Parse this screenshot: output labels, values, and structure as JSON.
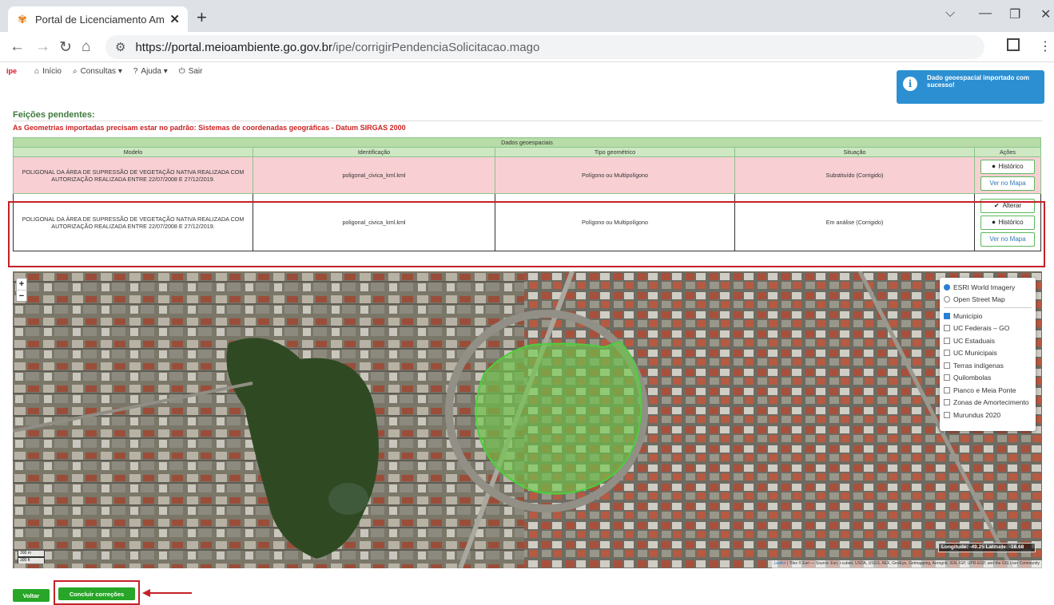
{
  "browser": {
    "tab_title": "Portal de Licenciamento Ambient",
    "tab_close": "✕",
    "new_tab": "+",
    "url_host": "https://portal.meioambiente.go.gov.br",
    "url_path": "/ipe/corrigirPendenciaSolicitacao.mago",
    "window_controls": [
      "⌵",
      "—",
      "❐",
      "✕"
    ]
  },
  "app_menu": {
    "logo": "ipe",
    "items": [
      {
        "icon": "home-icon",
        "glyph": "⌂",
        "label": "Início"
      },
      {
        "icon": "search-icon",
        "glyph": "⌕",
        "label": "Consultas ▾"
      },
      {
        "icon": "help-icon",
        "glyph": "?",
        "label": "Ajuda ▾"
      },
      {
        "icon": "power-icon",
        "glyph": "⏻",
        "label": "Sair"
      }
    ]
  },
  "toast": {
    "message": "Dado geoespacial importado com sucesso!",
    "color": "#2b8fd2"
  },
  "page": {
    "section_title": "Feições pendentes:",
    "warning": "As Geometrias importadas precisam estar no padrão: Sistemas de coordenadas geográficas - Datum SIRGAS 2000"
  },
  "table": {
    "group_header": "Dados geoespaciais",
    "columns": [
      "Modelo",
      "Identificação",
      "Tipo geométrico",
      "Situação",
      "Ações"
    ],
    "rows": [
      {
        "modelo": "POLIGONAL DA ÁREA DE SUPRESSÃO DE VEGETAÇÃO NATIVA REALIZADA COM AUTORIZAÇÃO REALIZADA ENTRE 22/07/2008 E 27/12/2019.",
        "identificacao": "poligonal_civica_kml.kml",
        "tipo": "Polígono ou Multipolígono",
        "situacao": "Substituído (Corrigido)",
        "btn_historico": "Histórico",
        "btn_mapa": "Ver no Mapa"
      },
      {
        "modelo": "POLIGONAL DA ÁREA DE SUPRESSÃO DE VEGETAÇÃO NATIVA REALIZADA COM AUTORIZAÇÃO REALIZADA ENTRE 22/07/2008 E 27/12/2019.",
        "identificacao": "poligonal_civica_kml.kml",
        "tipo": "Polígono ou Multipolígono",
        "situacao": "Em análise (Corrigido)",
        "btn_alterar": "Alterar",
        "btn_historico": "Histórico",
        "btn_mapa": "Ver no Mapa"
      }
    ]
  },
  "map": {
    "zoom_in": "+",
    "zoom_out": "−",
    "base_layers": [
      {
        "label": "ESRI World Imagery",
        "checked": true
      },
      {
        "label": "Open Street Map",
        "checked": false
      }
    ],
    "overlays": [
      {
        "label": "Município",
        "checked": true
      },
      {
        "label": "UC Federais – GO",
        "checked": false
      },
      {
        "label": "UC Estaduais",
        "checked": false
      },
      {
        "label": "UC Municipais",
        "checked": false
      },
      {
        "label": "Terras indígenas",
        "checked": false
      },
      {
        "label": "Quilombolas",
        "checked": false
      },
      {
        "label": "Pianco e Meia Ponte",
        "checked": false
      },
      {
        "label": "Zonas de Amortecimento",
        "checked": false
      },
      {
        "label": "Murundus 2020",
        "checked": false
      }
    ],
    "scale_m": "300 m",
    "scale_ft": "300 ft",
    "coords": "Longitude: -49.25 Latitude: -16.68",
    "attribution_leaflet": "Leaflet",
    "attribution_rest": " | Tiles © Esri — Source: Esri, i-cubed, USDA, USGS, AEX, GeoEye, Getmapping, Aerogrid, IGN, IGP, UPR-EGP, and the GIS User Community"
  },
  "footer": {
    "voltar": "Voltar",
    "concluir": "Concluir correções"
  },
  "colors": {
    "accent_green": "#27a627",
    "highlight_red": "#c42128",
    "row_red": "#f8d0d4",
    "header_green": "#b7dca7"
  }
}
